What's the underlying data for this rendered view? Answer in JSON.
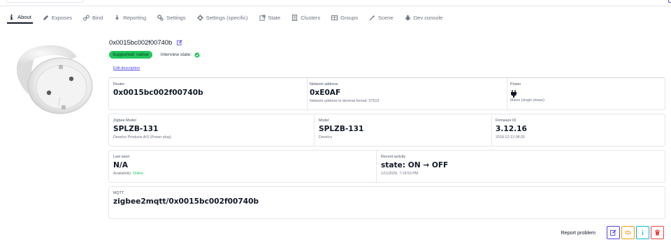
{
  "tabs": [
    {
      "label": "About",
      "icon": "info-icon",
      "active": true
    },
    {
      "label": "Exposes",
      "icon": "pencil-icon"
    },
    {
      "label": "Bind",
      "icon": "link-icon"
    },
    {
      "label": "Reporting",
      "icon": "download-icon"
    },
    {
      "label": "Settings",
      "icon": "cogs-icon"
    },
    {
      "label": "Settings (specific)",
      "icon": "gear-icon"
    },
    {
      "label": "State",
      "icon": "external-link-icon"
    },
    {
      "label": "Clusters",
      "icon": "server-icon"
    },
    {
      "label": "Groups",
      "icon": "table-icon"
    },
    {
      "label": "Scene",
      "icon": "magic-wand-icon"
    },
    {
      "label": "Dev console",
      "icon": "bug-icon"
    }
  ],
  "device": {
    "title": "0x0015bc002f00740b",
    "supported_badge": "Supported: native",
    "interview_label": "Interview state:",
    "edit_description": "Edit description"
  },
  "router": {
    "label": "Router",
    "value": "0x0015bc002f00740b"
  },
  "network": {
    "label": "Network address",
    "value": "0xE0AF",
    "sub": "Network address in decimal format: 57519"
  },
  "power": {
    "label": "Power",
    "sub": "Mains (single phase)"
  },
  "zigbee_model": {
    "label": "Zigbee Model",
    "value": "SPLZB-131",
    "sub": "Develco Products A/S (Power plug)"
  },
  "model": {
    "label": "Model",
    "value": "SPLZB-131",
    "sub": "Develco"
  },
  "firmware": {
    "label": "Firmware ID",
    "value": "3.12.16",
    "sub": "2018-12-13 08:26"
  },
  "last_seen": {
    "label": "Last seen",
    "value": "N/A",
    "availability_label": "Availability:",
    "availability_value": "Online"
  },
  "recent": {
    "label": "Recent activity",
    "value": "state: ON → OFF",
    "sub": "1/11/2026, 7:19:53 PM"
  },
  "mqtt": {
    "label": "MQTT",
    "value": "zigbee2mqtt/0x0015bc002f00740b"
  },
  "footer": {
    "report_label": "Report problem"
  },
  "colors": {
    "accent": "#4f46e5",
    "success": "#22c55e",
    "warning": "#f59e0b",
    "info": "#06b6d4",
    "danger": "#ef4444"
  }
}
